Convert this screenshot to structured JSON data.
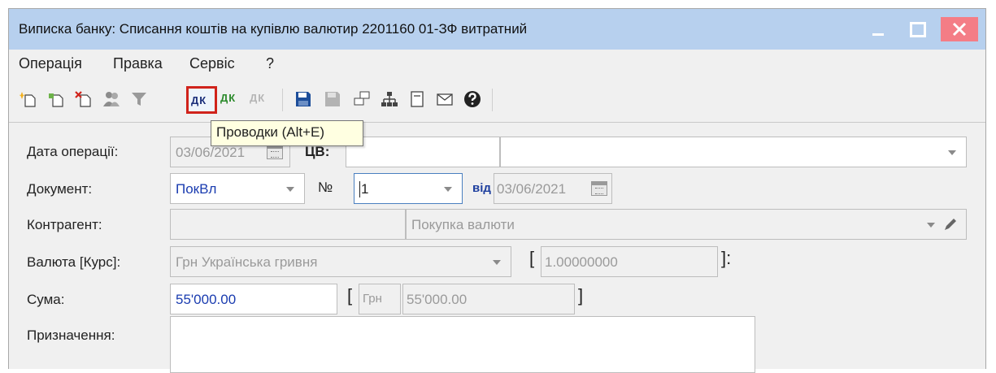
{
  "window": {
    "title": "Виписка банку: Списання коштів на купівлю валютир 2201160 01-ЗФ витратний"
  },
  "menu": {
    "items": [
      "Операція",
      "Правка",
      "Сервіс",
      "?"
    ]
  },
  "toolbar": {
    "dk_label": "ДК",
    "tooltip": "Проводки (Alt+E)"
  },
  "form": {
    "date_label": "Дата операції:",
    "date_value": "03/06/2021",
    "cv_label": "ЦВ:",
    "document_label": "Документ:",
    "document_value": "ПокВл",
    "number_label": "№",
    "number_value": "1",
    "from_label": "від",
    "from_value": "03/06/2021",
    "counterparty_label": "Контрагент:",
    "counterparty_desc": "Покупка валюти",
    "currency_label": "Валюта [Курс]:",
    "currency_value": "Грн Українська гривня",
    "rate_open": "[",
    "rate_value": "1.00000000",
    "rate_close": "]:",
    "sum_label": "Сума:",
    "sum_value": "55'000.00",
    "sum_bracket_open": "[",
    "sum_currency": "Грн",
    "sum_equiv": "55'000.00",
    "sum_bracket_close": "]",
    "purpose_label": "Призначення:"
  },
  "colors": {
    "titlebar": "#b7d0ee",
    "close_button": "#f47d86",
    "highlight_border": "#d0231b",
    "tooltip_bg": "#ffffe1"
  }
}
